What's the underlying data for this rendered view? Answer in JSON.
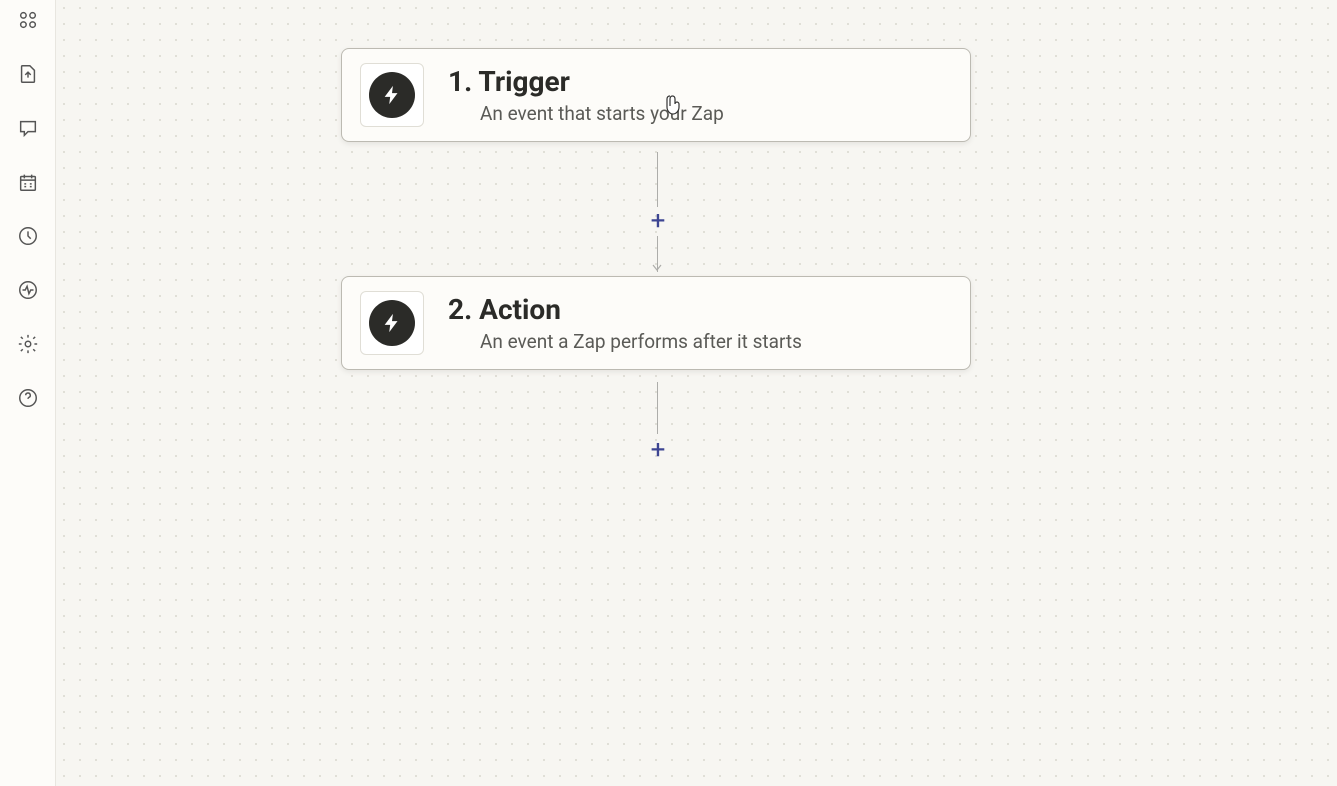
{
  "sidebar": {
    "items": [
      {
        "name": "apps-icon"
      },
      {
        "name": "import-icon"
      },
      {
        "name": "comment-icon"
      },
      {
        "name": "calendar-icon"
      },
      {
        "name": "history-icon"
      },
      {
        "name": "activity-icon"
      },
      {
        "name": "settings-icon"
      },
      {
        "name": "help-icon"
      }
    ]
  },
  "steps": [
    {
      "title": "1. Trigger",
      "subtitle": "An event that starts your Zap",
      "icon": "bolt-icon"
    },
    {
      "title": "2. Action",
      "subtitle": "An event a Zap performs after it starts",
      "icon": "bolt-icon"
    }
  ],
  "addStepLabel": "+",
  "colors": {
    "accent": "#3d4592",
    "card_bg": "#fdfcf9",
    "canvas_bg": "#f7f6f2",
    "icon_dark": "#2b2b28"
  }
}
